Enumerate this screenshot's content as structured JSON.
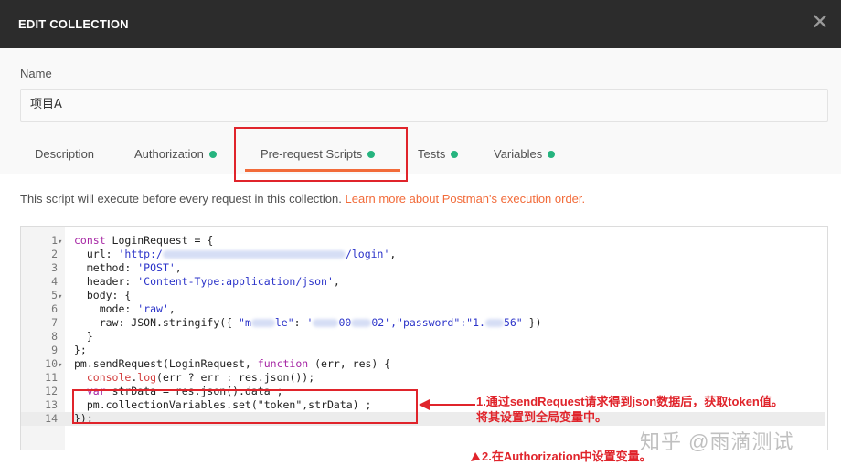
{
  "header": {
    "title": "EDIT COLLECTION"
  },
  "name": {
    "label": "Name",
    "value": "项目A"
  },
  "tabs": [
    {
      "label": "Description",
      "dot": false
    },
    {
      "label": "Authorization",
      "dot": true
    },
    {
      "label": "Pre-request Scripts",
      "dot": true,
      "active": true
    },
    {
      "label": "Tests",
      "dot": true
    },
    {
      "label": "Variables",
      "dot": true
    }
  ],
  "info": {
    "text": "This script will execute before every request in this collection. ",
    "link": "Learn more about Postman's execution order."
  },
  "code": {
    "line_numbers": [
      "1",
      "2",
      "3",
      "4",
      "5",
      "6",
      "7",
      "8",
      "9",
      "10",
      "11",
      "12",
      "13",
      "14"
    ],
    "l1": {
      "kw": "const",
      "rest": " LoginRequest = {"
    },
    "l2": {
      "key": "  url: ",
      "s1": "'http:/",
      "s2": "/login'",
      "tail": ","
    },
    "l3": {
      "key": "  method: ",
      "s": "'POST'",
      "tail": ","
    },
    "l4": {
      "key": "  header: ",
      "s": "'Content-Type:application/json'",
      "tail": ","
    },
    "l5": {
      "text": "  body: {"
    },
    "l6": {
      "key": "    mode: ",
      "s": "'raw'",
      "tail": ","
    },
    "l7": {
      "key": "    raw: JSON.stringify({ ",
      "s1": "\"m",
      "s2": "le\"",
      "mid": ": ",
      "s3": "'",
      "s4": "00",
      "s5": "02'",
      "s6": ",\"password\":\"1.",
      "s7": "56\"",
      "tail": " })"
    },
    "l8": {
      "text": "  }"
    },
    "l9": {
      "text": "};"
    },
    "l10": {
      "pre": "pm.sendRequest(LoginRequest, ",
      "kw": "function",
      "post": " (err, res) {"
    },
    "l11": {
      "pre": "  ",
      "fn1": "console",
      "dot": ".",
      "fn2": "log",
      "post": "(err ? err : res.json());"
    },
    "l12": {
      "pre": "  ",
      "kw": "var",
      "post": " strData = res.json().data ;"
    },
    "l13": {
      "text": "  pm.collectionVariables.set(\"token\",strData) ;"
    },
    "l14": {
      "text": "});"
    }
  },
  "annotations": {
    "note1_line1": "1.通过sendRequest请求得到json数据后，获取token值。",
    "note1_line2": "将其设置到全局变量中。",
    "note2": "2.在Authorization中设置变量。"
  },
  "watermark": "知乎 @雨滴测试",
  "colors": {
    "accent": "#f26b3a",
    "dot": "#26b47f",
    "highlight": "#e0242b",
    "titlebar": "#2c2c2c"
  },
  "icons": {
    "close": "close-icon",
    "arrow": "arrow-left-icon"
  }
}
